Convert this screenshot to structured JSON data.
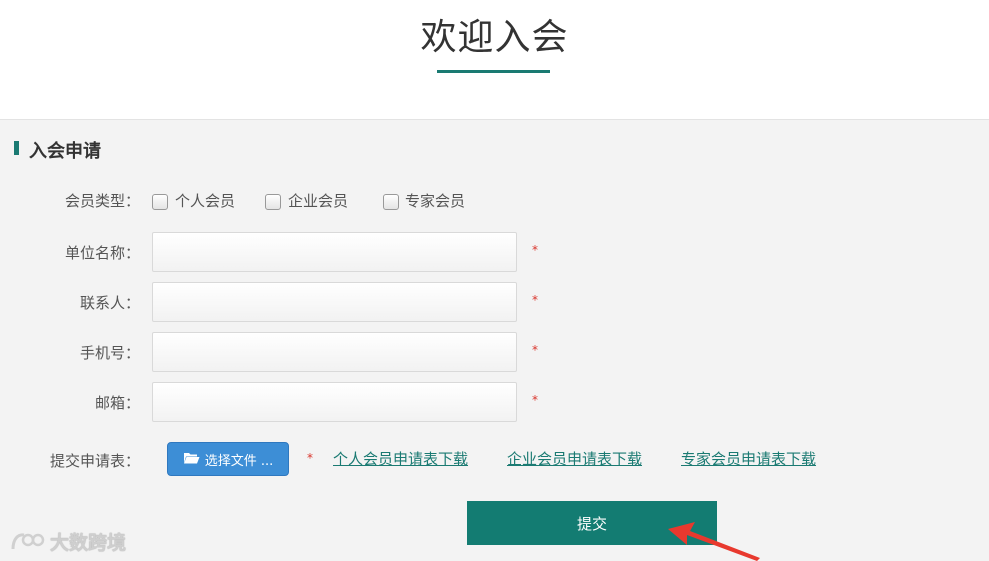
{
  "header": {
    "title": "欢迎入会"
  },
  "section": {
    "title": "入会申请"
  },
  "member_type": {
    "label": "会员类型：",
    "options": [
      "个人会员",
      "企业会员",
      "专家会员"
    ]
  },
  "fields": [
    {
      "label": "单位名称：",
      "value": "",
      "required": "*"
    },
    {
      "label": "联系人：",
      "value": "",
      "required": "*"
    },
    {
      "label": "手机号：",
      "value": "",
      "required": "*"
    },
    {
      "label": "邮箱：",
      "value": "",
      "required": "*"
    }
  ],
  "upload": {
    "label": "提交申请表：",
    "button_label": "选择文件 ...",
    "required": "*",
    "links": [
      "个人会员申请表下载",
      "企业会员申请表下载",
      "专家会员申请表下载"
    ]
  },
  "submit_label": "提交",
  "watermark": "大数跨境",
  "colors": {
    "accent": "#137c72",
    "file_button": "#3d8ed6",
    "required": "#d9342b",
    "arrow": "#e8392e"
  }
}
